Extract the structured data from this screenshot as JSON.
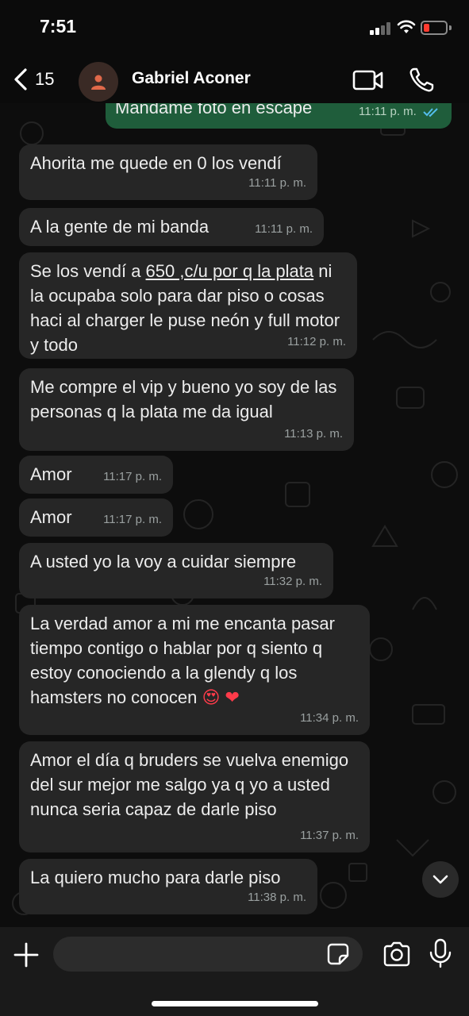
{
  "status_bar": {
    "time": "7:51"
  },
  "header": {
    "back_count": "15",
    "contact_name": "Gabriel Aconer",
    "icons": {
      "back": "chevron-left-icon",
      "avatar": "person-icon",
      "video": "video-call-icon",
      "phone": "phone-icon"
    }
  },
  "messages": [
    {
      "id": "m0",
      "direction": "outgoing",
      "text": "Mandame foto en escape",
      "time": "11:11 p. m.",
      "read": true
    },
    {
      "id": "m1",
      "direction": "incoming",
      "text": "Ahorita me quede en 0 los vendí",
      "time": "11:11 p. m."
    },
    {
      "id": "m2",
      "direction": "incoming",
      "text": "A la gente de mi banda",
      "time": "11:11 p. m."
    },
    {
      "id": "m3",
      "direction": "incoming",
      "text_underlined": "650 ,c/u por q la plata",
      "text_before": "Se los vendí a ",
      "text_after": "ni la ocupaba solo para dar piso o cosas haci al charger le puse neón y full motor y todo",
      "time": "11:12 p. m."
    },
    {
      "id": "m4",
      "direction": "incoming",
      "text": "Me compre el vip y bueno yo soy de las personas q la plata me da igual",
      "time": "11:13 p. m."
    },
    {
      "id": "m5",
      "direction": "incoming",
      "text": "Amor",
      "time": "11:17 p. m."
    },
    {
      "id": "m6",
      "direction": "incoming",
      "text": "Amor",
      "time": "11:17 p. m."
    },
    {
      "id": "m7",
      "direction": "incoming",
      "text": "A usted yo la voy a cuidar siempre",
      "time": "11:32 p. m."
    },
    {
      "id": "m8",
      "direction": "incoming",
      "text": "La verdad amor a mi me encanta pasar tiempo contigo o hablar por q siento q estoy conociendo a la glendy q los hamsters no conocen",
      "emoji": "😍 ❤",
      "time": "11:34 p. m."
    },
    {
      "id": "m9",
      "direction": "incoming",
      "text": "Amor el día q bruders se vuelva enemigo del sur mejor me salgo ya q yo a usted nunca seria capaz de darle piso",
      "time": "11:37 p. m."
    },
    {
      "id": "m10",
      "direction": "incoming",
      "text": "La quiero mucho para darle piso",
      "time": "11:38 p. m."
    }
  ],
  "input_bar": {
    "placeholder": "",
    "icons": {
      "plus": "plus-icon",
      "sticker": "sticker-icon",
      "camera": "camera-icon",
      "mic": "microphone-icon",
      "scroll": "chevron-down-icon"
    }
  },
  "colors": {
    "incoming_bubble": "#262626",
    "outgoing_bubble": "#1f5d3b",
    "read_tick": "#53bdeb",
    "battery_low": "#ff3b30"
  }
}
